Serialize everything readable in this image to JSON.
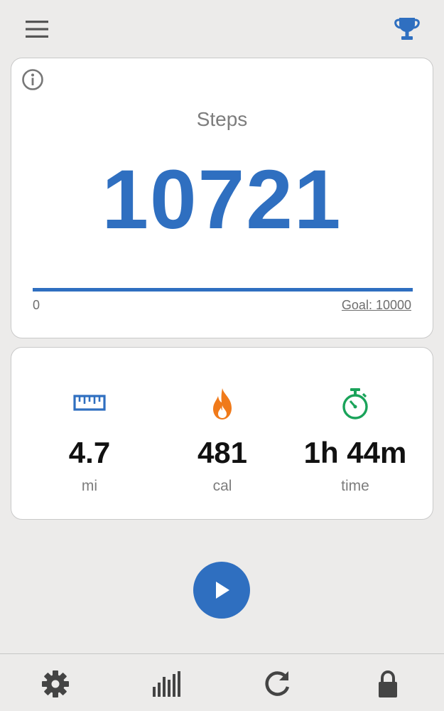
{
  "header": {
    "menu_icon": "hamburger-menu-icon",
    "trophy_icon": "trophy-icon"
  },
  "steps_card": {
    "info_icon": "info-icon",
    "label": "Steps",
    "count": "10721",
    "progress": {
      "min_label": "0",
      "goal_label": "Goal: 10000",
      "fraction": 1.0
    }
  },
  "stats": {
    "distance": {
      "icon": "ruler-icon",
      "value": "4.7",
      "unit": "mi"
    },
    "calories": {
      "icon": "flame-icon",
      "value": "481",
      "unit": "cal"
    },
    "time": {
      "icon": "stopwatch-icon",
      "value": "1h 44m",
      "unit": "time"
    }
  },
  "play_button": {
    "icon": "play-icon"
  },
  "bottom_nav": {
    "items": [
      {
        "icon": "gear-icon"
      },
      {
        "icon": "bar-chart-icon"
      },
      {
        "icon": "refresh-icon"
      },
      {
        "icon": "lock-icon"
      }
    ]
  },
  "colors": {
    "accent": "#2f6fc0",
    "flame": "#f07a1a",
    "stopwatch": "#1aa35a",
    "background": "#ecebea"
  }
}
